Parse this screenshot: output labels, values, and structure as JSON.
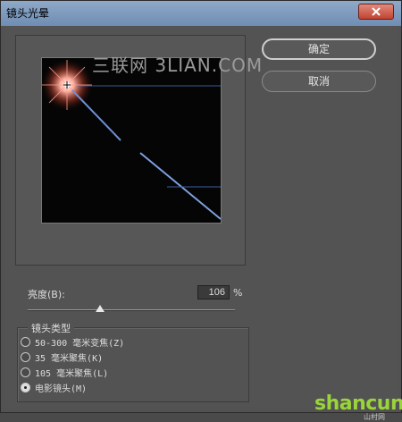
{
  "window": {
    "title": "镜头光晕"
  },
  "watermark": "三联网 3LIAN.COM",
  "buttons": {
    "ok": "确定",
    "cancel": "取消"
  },
  "brightness": {
    "label": "亮度(B):",
    "value": "106",
    "unit": "%",
    "slider_fraction": 0.35
  },
  "lens_type": {
    "title": "镜头类型",
    "options": [
      {
        "label": "50-300 毫米变焦(Z)",
        "checked": false
      },
      {
        "label": "35 毫米聚焦(K)",
        "checked": false
      },
      {
        "label": "105 毫米聚焦(L)",
        "checked": false
      },
      {
        "label": "电影镜头(M)",
        "checked": true
      }
    ]
  },
  "logo": {
    "text": "shancun",
    "sub": "山村网"
  },
  "colors": {
    "titlebar": "#7f9bbd",
    "panel": "#535353",
    "preview_bg": "#050505",
    "flare_streak": "#6f8fd6"
  }
}
